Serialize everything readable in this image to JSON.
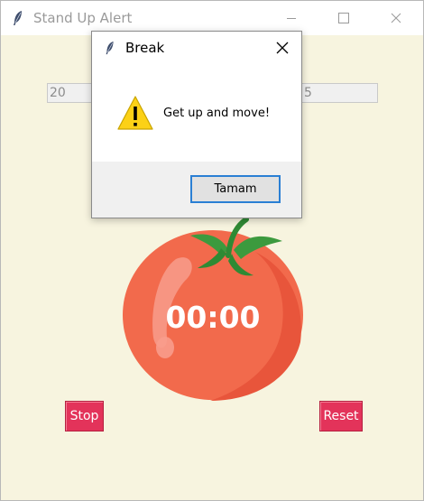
{
  "main_window": {
    "title": "Stand Up Alert",
    "work_minutes": "20",
    "break_minutes": "5",
    "timer": "00:00",
    "stop_label": "Stop",
    "reset_label": "Reset",
    "background_color": "#f7f4df",
    "button_color": "#e3335a",
    "icons": [
      "feather-icon",
      "minimize-icon",
      "maximize-icon",
      "close-icon",
      "tomato-icon"
    ]
  },
  "dialog": {
    "title": "Break",
    "message": "Get up and move!",
    "ok_label": "Tamam",
    "icons": [
      "feather-icon",
      "close-icon",
      "warning-icon"
    ]
  }
}
